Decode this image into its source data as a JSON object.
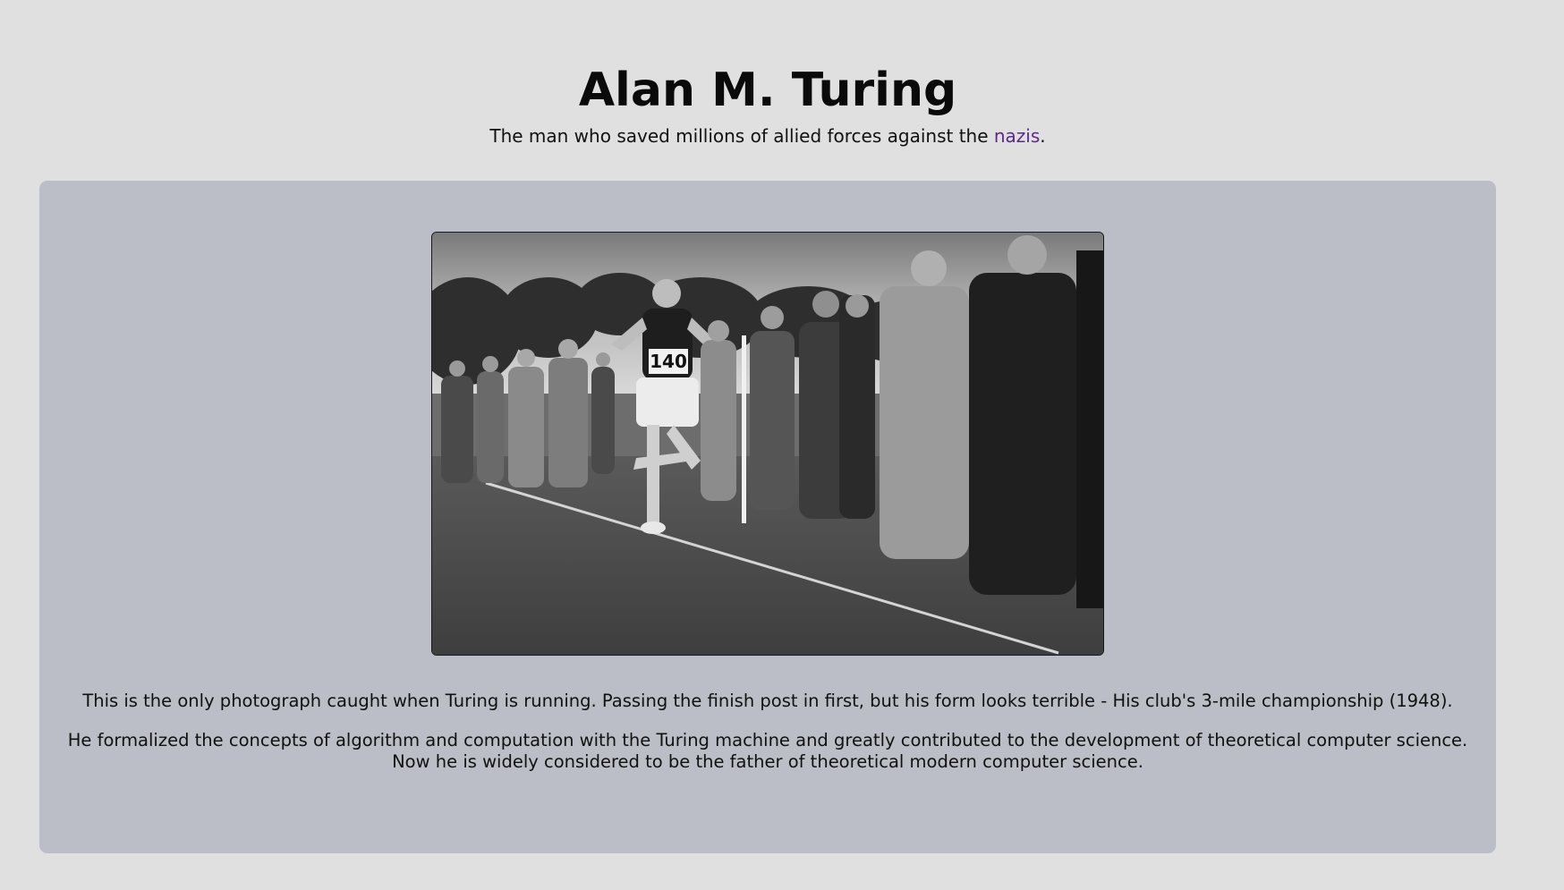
{
  "header": {
    "title": "Alan M. Turing",
    "subtitle_before": "The man who saved millions of allied forces against the ",
    "subtitle_link": "nazis",
    "subtitle_after": "."
  },
  "photo": {
    "icon": "photograph-runner",
    "bib_number": "140"
  },
  "captions": {
    "photo_caption": "This is the only photograph caught when Turing is running. Passing the finish post in first, but his form looks terrible - His club's 3-mile championship (1948).",
    "bio_line_1": "He formalized the concepts of algorithm and computation with the Turing machine and greatly contributed to the development of theoretical computer science.",
    "bio_line_2": "Now he is widely considered to be the father of theoretical modern computer science."
  },
  "colors": {
    "page_background": "#e0e0e0",
    "card_background": "#bbbec6",
    "link_color": "#5b2a86"
  }
}
